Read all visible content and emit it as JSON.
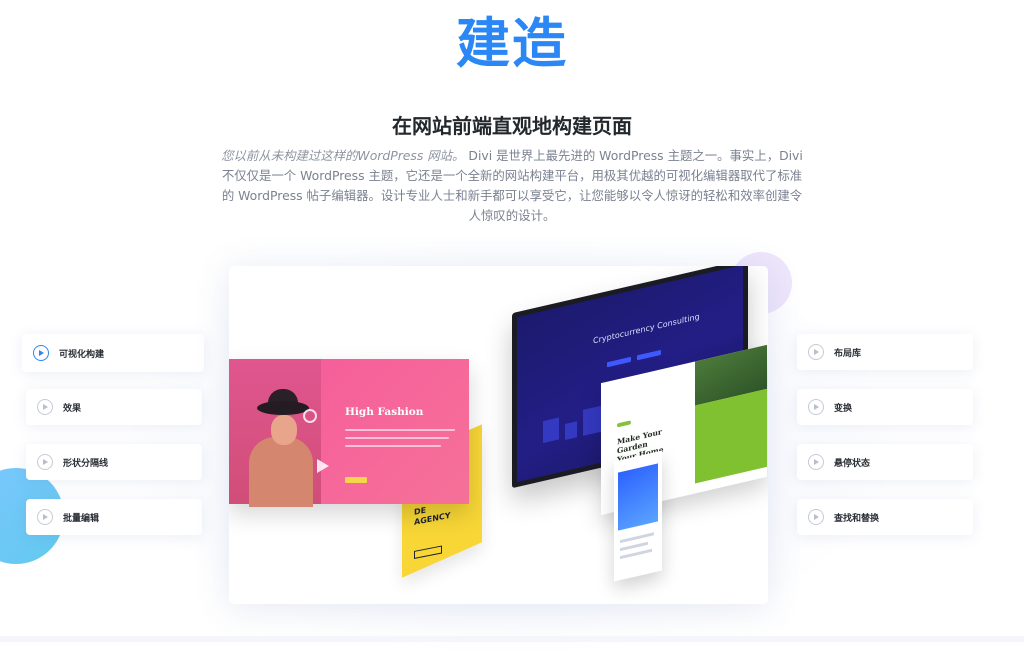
{
  "hero": {
    "title": "建造"
  },
  "section": {
    "heading": "在网站前端直观地构建页面",
    "intro_italic": "您以前从未构建过这样的WordPress 网站。",
    "intro_rest": "Divi 是世界上最先进的 WordPress 主题之一。事实上，Divi 不仅仅是一个 WordPress 主题，它还是一个全新的网站构建平台，用极其优越的可视化编辑器取代了标准的 WordPress 帖子编辑器。设计专业人士和新手都可以享受它，让您能够以令人惊讶的轻松和效率创建令人惊叹的设计。"
  },
  "features_left": [
    {
      "label": "可视化构建",
      "active": true
    },
    {
      "label": "效果",
      "active": false
    },
    {
      "label": "形状分隔线",
      "active": false
    },
    {
      "label": "批量编辑",
      "active": false
    }
  ],
  "features_right": [
    {
      "label": "布局库",
      "active": false
    },
    {
      "label": "变换",
      "active": false
    },
    {
      "label": "悬停状态",
      "active": false
    },
    {
      "label": "查找和替换",
      "active": false
    }
  ],
  "showcase": {
    "fashion_title": "High Fashion",
    "agency_text_1": "DE",
    "agency_text_2": "AGENCY",
    "crypto_title": "Cryptocurrency Consulting",
    "garden_title_1": "Make Your Garden",
    "garden_title_2": "Your Home"
  },
  "colors": {
    "accent": "#2b87f5",
    "pink": "#f7599a",
    "yellow": "#f7d636",
    "crypto_blue": "#231e86",
    "green": "#7fc131"
  }
}
